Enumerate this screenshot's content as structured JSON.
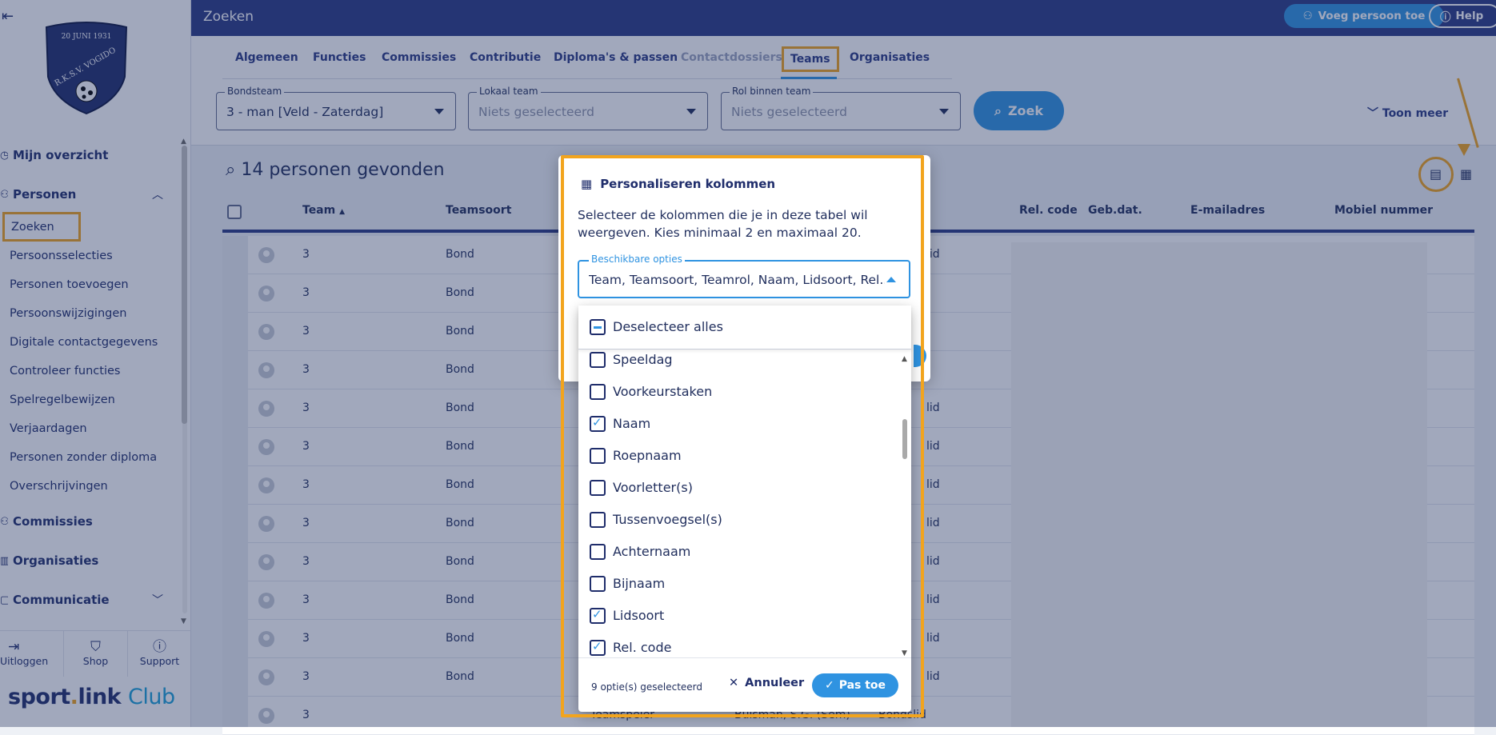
{
  "header": {
    "title": "Zoeken",
    "add_person_label": "Voeg persoon toe",
    "help_label": "Help"
  },
  "sidebar": {
    "club_logo_text": "R.K.S.V. VOGIDO",
    "club_logo_date": "20 JUNI 1931",
    "sections": {
      "overview": "Mijn overzicht",
      "personen": "Personen",
      "commissies": "Commissies",
      "organisaties": "Organisaties",
      "communicatie": "Communicatie"
    },
    "items": [
      "Zoeken",
      "Persoonsselecties",
      "Personen toevoegen",
      "Persoonswijzigingen",
      "Digitale contactgegevens",
      "Controleer functies",
      "Spelregelbewijzen",
      "Verjaardagen",
      "Personen zonder diploma",
      "Overschrijvingen"
    ],
    "bottom": {
      "logout": "Uitloggen",
      "shop": "Shop",
      "support": "Support"
    },
    "brand": {
      "part1": "sport",
      "dot": ".",
      "part2": "link",
      "part3": "Club"
    }
  },
  "tabs": [
    "Algemeen",
    "Functies",
    "Commissies",
    "Contributie",
    "Diploma's & passen",
    "Contactdossiers",
    "Teams",
    "Organisaties"
  ],
  "filters": {
    "bondsteam": {
      "label": "Bondsteam",
      "value": "3 - man [Veld - Zaterdag]"
    },
    "lokaal_team": {
      "label": "Lokaal team",
      "value": "Niets geselecteerd"
    },
    "rol": {
      "label": "Rol binnen team",
      "value": "Niets geselecteerd"
    },
    "search_button": "Zoek",
    "toggle_more": "Toon meer"
  },
  "results": {
    "title": "14 personen gevonden",
    "columns": [
      "Team",
      "Teamsoort",
      "Rel. code",
      "Geb.dat.",
      "E-mailadres",
      "Mobiel nummer"
    ],
    "rows": [
      {
        "team": "3",
        "soort": "Bond",
        "rest": "lid"
      },
      {
        "team": "3",
        "soort": "Bond",
        "rest": ""
      },
      {
        "team": "3",
        "soort": "Bond",
        "rest": ""
      },
      {
        "team": "3",
        "soort": "Bond",
        "rest": ""
      },
      {
        "team": "3",
        "soort": "Bond",
        "rest": "lid"
      },
      {
        "team": "3",
        "soort": "Bond",
        "rest": "lid"
      },
      {
        "team": "3",
        "soort": "Bond",
        "rest": "lid"
      },
      {
        "team": "3",
        "soort": "Bond",
        "rest": "lid"
      },
      {
        "team": "3",
        "soort": "Bond",
        "rest": "lid"
      },
      {
        "team": "3",
        "soort": "Bond",
        "rest": "lid"
      },
      {
        "team": "3",
        "soort": "Bond",
        "rest": "lid"
      },
      {
        "team": "3",
        "soort": "Bond",
        "rest": "lid"
      }
    ],
    "last_row": {
      "team": "3",
      "rol": "Teamspeler",
      "naam": "Buisman, S.G. (Sem)",
      "lidsoort": "Bondslid"
    }
  },
  "dialog": {
    "title": "Personaliseren kolommen",
    "description": "Selecteer de kolommen die je in deze tabel wil weergeven. Kies minimaal 2 en maximaal 20.",
    "select_label": "Beschikbare opties",
    "select_value": "Team, Teamsoort, Teamrol, Naam, Lidsoort, Rel...",
    "deselect_all": "Deselecteer alles",
    "options": [
      {
        "label": "Speeldag",
        "checked": false
      },
      {
        "label": "Voorkeurstaken",
        "checked": false
      },
      {
        "label": "Naam",
        "checked": true
      },
      {
        "label": "Roepnaam",
        "checked": false
      },
      {
        "label": "Voorletter(s)",
        "checked": false
      },
      {
        "label": "Tussenvoegsel(s)",
        "checked": false
      },
      {
        "label": "Achternaam",
        "checked": false
      },
      {
        "label": "Bijnaam",
        "checked": false
      },
      {
        "label": "Lidsoort",
        "checked": true
      },
      {
        "label": "Rel. code",
        "checked": true
      }
    ],
    "selected_count": "9 optie(s) geselecteerd",
    "cancel": "Annuleer",
    "apply": "Pas toe"
  },
  "colors": {
    "primary": "#2a3a83",
    "accent": "#2f93e1",
    "highlight": "#f2a41d"
  }
}
